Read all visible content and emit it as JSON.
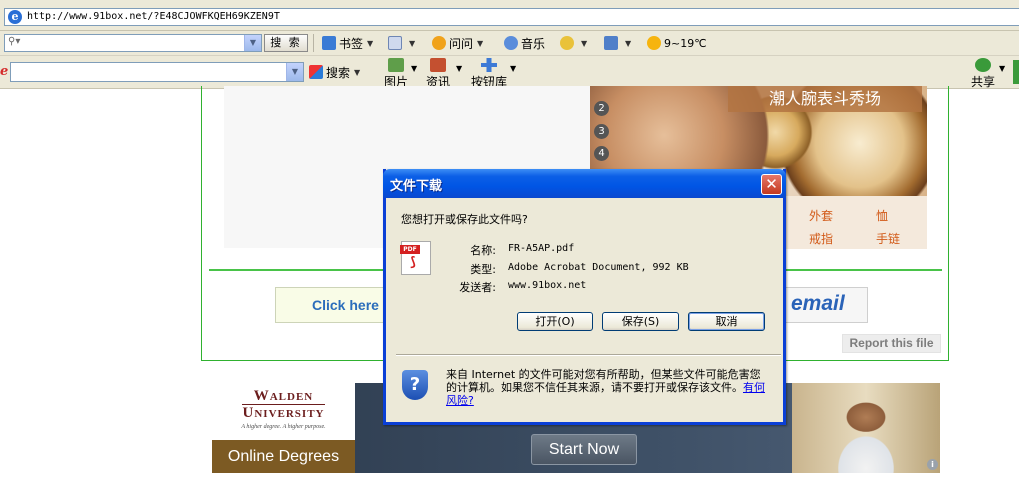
{
  "address_bar": {
    "url": "http://www.91box.net/?E48CJOWFKQEH69KZEN9T"
  },
  "toolbar1": {
    "search_placeholder": "",
    "search_button": "搜 索",
    "bookmarks": "书签",
    "qa": "问问",
    "music": "音乐",
    "weather": "9~19℃"
  },
  "toolbar2": {
    "logo": "e",
    "search": "搜索",
    "images": "图片",
    "news": "资讯",
    "button_lib": "按钮库",
    "share": "共享"
  },
  "ad_watch": {
    "title": "潮人腕表斗秀场",
    "numbers": [
      "2",
      "3",
      "4"
    ],
    "links": [
      "外套",
      "恤",
      "戒指",
      "手链"
    ]
  },
  "page": {
    "click_here": "Click here",
    "email": "email",
    "report": "Report this file"
  },
  "walden_ad": {
    "name_line1": "Walden",
    "name_line2": "University",
    "tagline": "A higher degree. A higher purpose.",
    "online": "Online Degrees",
    "start": "Start Now",
    "adchoice": "i"
  },
  "dialog": {
    "title": "文件下载",
    "close": "✕",
    "question": "您想打开或保存此文件吗?",
    "name_label": "名称:",
    "name_value": "FR-A5AP.pdf",
    "type_label": "类型:",
    "type_value": "Adobe Acrobat Document, 992 KB",
    "from_label": "发送者:",
    "from_value": "www.91box.net",
    "open_button": "打开(O)",
    "save_button": "保存(S)",
    "cancel_button": "取消",
    "warning": "来自 Internet 的文件可能对您有所帮助，但某些文件可能危害您的计算机。如果您不信任其来源，请不要打开或保存该文件。",
    "risk_link": "有何风险?"
  }
}
